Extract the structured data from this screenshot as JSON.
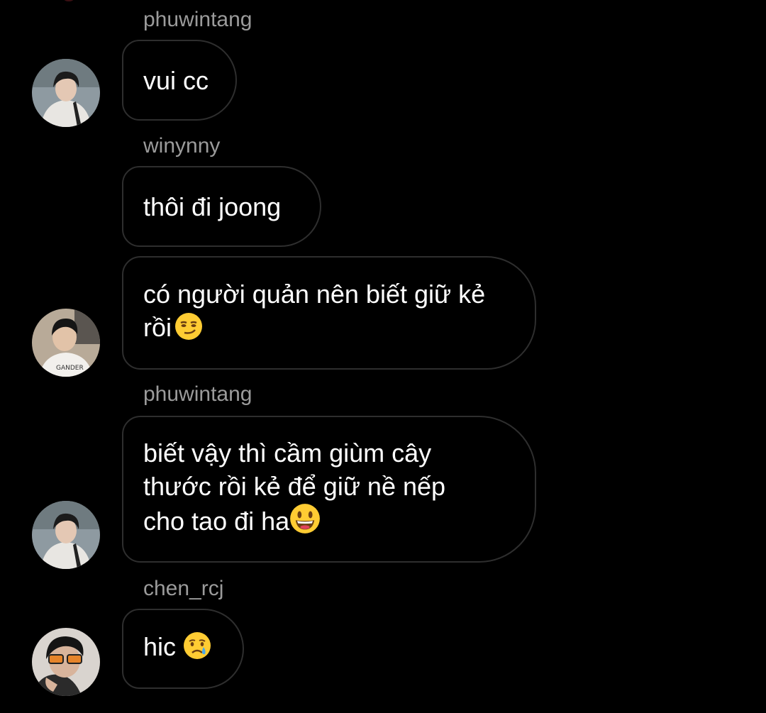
{
  "messages": [
    {
      "username": "phuwintang",
      "text": "vui cc",
      "emoji": "",
      "avatar": "avatar-phuwintang"
    },
    {
      "username": "winynny",
      "text": "thôi đi joong",
      "emoji": ""
    },
    {
      "username": "",
      "text": "có người quản nên biết giữ kẻ\nrồi",
      "emoji": "smirking-face-emoji",
      "avatar": "avatar-winynny"
    },
    {
      "username": "phuwintang",
      "text": "biết vậy thì cầm giùm cây\nthước rồi kẻ để giữ nề nếp\ncho tao đi ha",
      "emoji": "grinning-face-emoji",
      "avatar": "avatar-phuwintang"
    },
    {
      "username": "chen_rcj",
      "text": "hic",
      "emoji": "crying-face-emoji",
      "avatar": "avatar-chen-rcj"
    }
  ],
  "colors": {
    "background": "#000000",
    "bubble_border": "#2e2e2e",
    "username": "#9b9b9b",
    "text": "#ffffff"
  }
}
